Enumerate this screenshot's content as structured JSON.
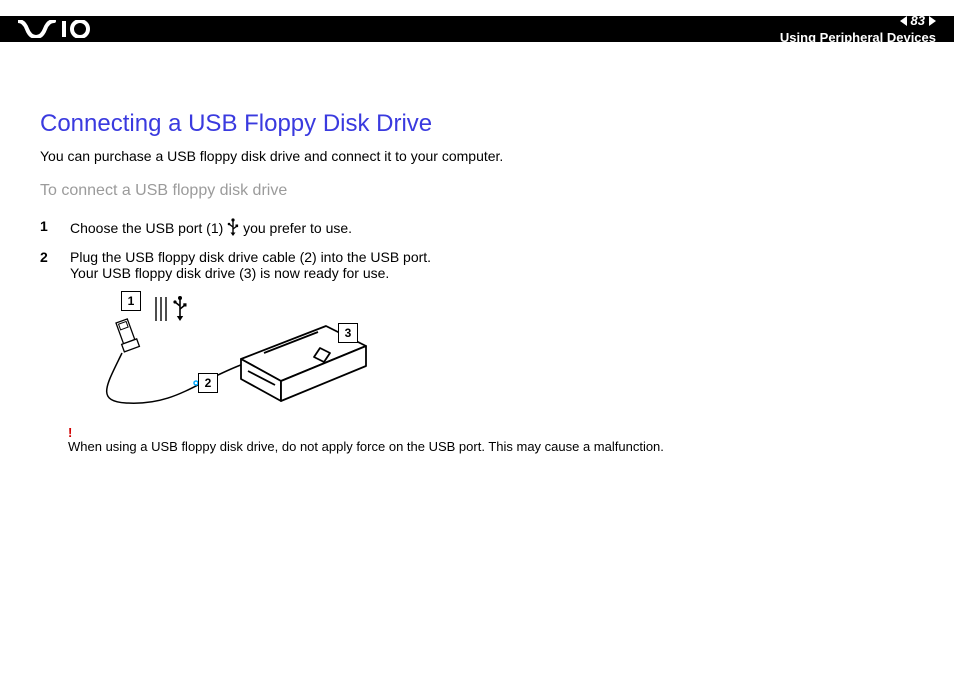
{
  "header": {
    "page_number": "83",
    "section": "Using Peripheral Devices"
  },
  "content": {
    "title": "Connecting a USB Floppy Disk Drive",
    "intro": "You can purchase a USB floppy disk drive and connect it to your computer.",
    "subtitle": "To connect a USB floppy disk drive",
    "steps": [
      {
        "num": "1",
        "text_before": "Choose the USB port (1) ",
        "text_after": " you prefer to use."
      },
      {
        "num": "2",
        "line1": "Plug the USB floppy disk drive cable (2) into the USB port.",
        "line2": "Your USB floppy disk drive (3) is now ready for use."
      }
    ],
    "diagram_labels": {
      "l1": "1",
      "l2": "2",
      "l3": "3"
    },
    "warning_mark": "!",
    "warning_text": "When using a USB floppy disk drive, do not apply force on the USB port. This may cause a malfunction."
  }
}
